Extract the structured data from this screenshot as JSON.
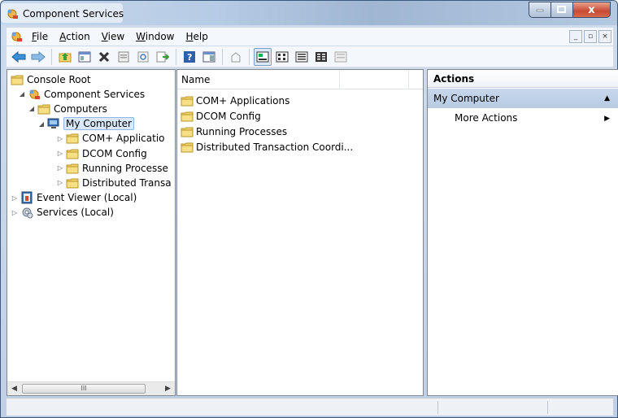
{
  "window": {
    "title": "Component Services"
  },
  "menu": {
    "items": [
      "File",
      "Action",
      "View",
      "Window",
      "Help"
    ],
    "underline": [
      "F",
      "A",
      "V",
      "W",
      "H"
    ]
  },
  "mdi": {
    "minimize": "_",
    "restore": "▫",
    "close": "×"
  },
  "caption": {
    "close": "x"
  },
  "tree": {
    "items": [
      {
        "label": "Console Root",
        "icon": "folder-icon",
        "expander": ""
      },
      {
        "label": "Component Services",
        "icon": "component-services-icon",
        "expander": "◢"
      },
      {
        "label": "Computers",
        "icon": "folder-icon",
        "expander": "◢"
      },
      {
        "label": "My Computer",
        "icon": "computer-icon",
        "expander": "◢"
      },
      {
        "label": "COM+ Applicatio",
        "icon": "folder-icon",
        "expander": "▷"
      },
      {
        "label": "DCOM Config",
        "icon": "folder-icon",
        "expander": "▷"
      },
      {
        "label": "Running Processe",
        "icon": "folder-icon",
        "expander": "▷"
      },
      {
        "label": "Distributed Transa",
        "icon": "folder-icon",
        "expander": "▷"
      },
      {
        "label": "Event Viewer (Local)",
        "icon": "event-viewer-icon",
        "expander": "▷"
      },
      {
        "label": "Services (Local)",
        "icon": "services-gear-icon",
        "expander": "▷"
      }
    ],
    "scroll_thumb": "III"
  },
  "list": {
    "columns": [
      "Name",
      ""
    ],
    "rows": [
      "COM+ Applications",
      "DCOM Config",
      "Running Processes",
      "Distributed Transaction Coordi..."
    ]
  },
  "actions": {
    "header": "Actions",
    "group": "My Computer",
    "items": [
      "More Actions"
    ]
  },
  "colors": {
    "selection": "#d9e8f9",
    "actions_group": "#c8d7ea",
    "folder": "#f2d36b"
  }
}
